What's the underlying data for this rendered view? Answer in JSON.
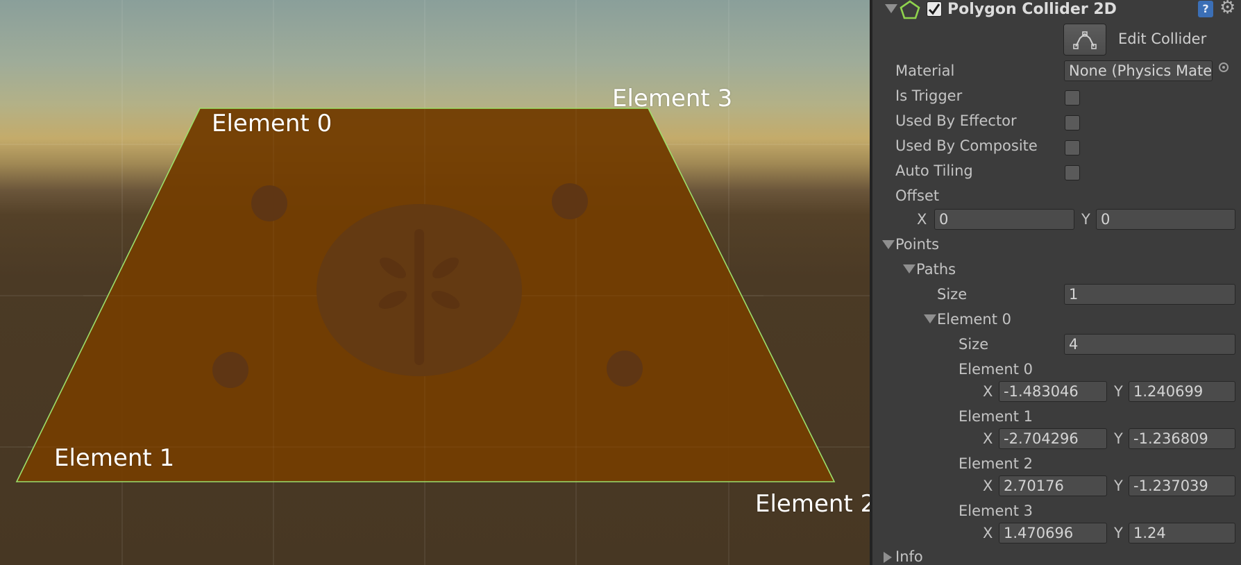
{
  "scene": {
    "labels": {
      "element_0": "Element 0",
      "element_1": "Element 1",
      "element_2": "Element 2",
      "element_3": "Element 3"
    },
    "colors": {
      "polygon_fill": "#723d02",
      "collider_outline": "#9ddf6a"
    }
  },
  "component": {
    "title": "Polygon Collider 2D",
    "enabled": true,
    "icons": [
      "collapse-triangle-icon",
      "pentagon-collider-icon",
      "help-icon",
      "gear-icon"
    ],
    "edit_collider_label": "Edit Collider",
    "material": {
      "label": "Material",
      "value": "None (Physics Mate"
    },
    "is_trigger": {
      "label": "Is Trigger",
      "checked": false
    },
    "used_by_effector": {
      "label": "Used By Effector",
      "checked": false
    },
    "used_by_composite": {
      "label": "Used By Composite",
      "checked": false
    },
    "auto_tiling": {
      "label": "Auto Tiling",
      "checked": false
    },
    "offset": {
      "label": "Offset",
      "x_label": "X",
      "x": "0",
      "y_label": "Y",
      "y": "0"
    },
    "points": {
      "label": "Points",
      "paths": {
        "label": "Paths",
        "size_label": "Size",
        "size": "1",
        "element": {
          "label": "Element 0",
          "size_label": "Size",
          "size": "4",
          "points": [
            {
              "label": "Element 0",
              "x_label": "X",
              "x": "-1.483046",
              "y_label": "Y",
              "y": "1.240699"
            },
            {
              "label": "Element 1",
              "x_label": "X",
              "x": "-2.704296",
              "y_label": "Y",
              "y": "-1.236809"
            },
            {
              "label": "Element 2",
              "x_label": "X",
              "x": "2.70176",
              "y_label": "Y",
              "y": "-1.237039"
            },
            {
              "label": "Element 3",
              "x_label": "X",
              "x": "1.470696",
              "y_label": "Y",
              "y": "1.24"
            }
          ]
        }
      }
    },
    "info_label": "Info"
  }
}
